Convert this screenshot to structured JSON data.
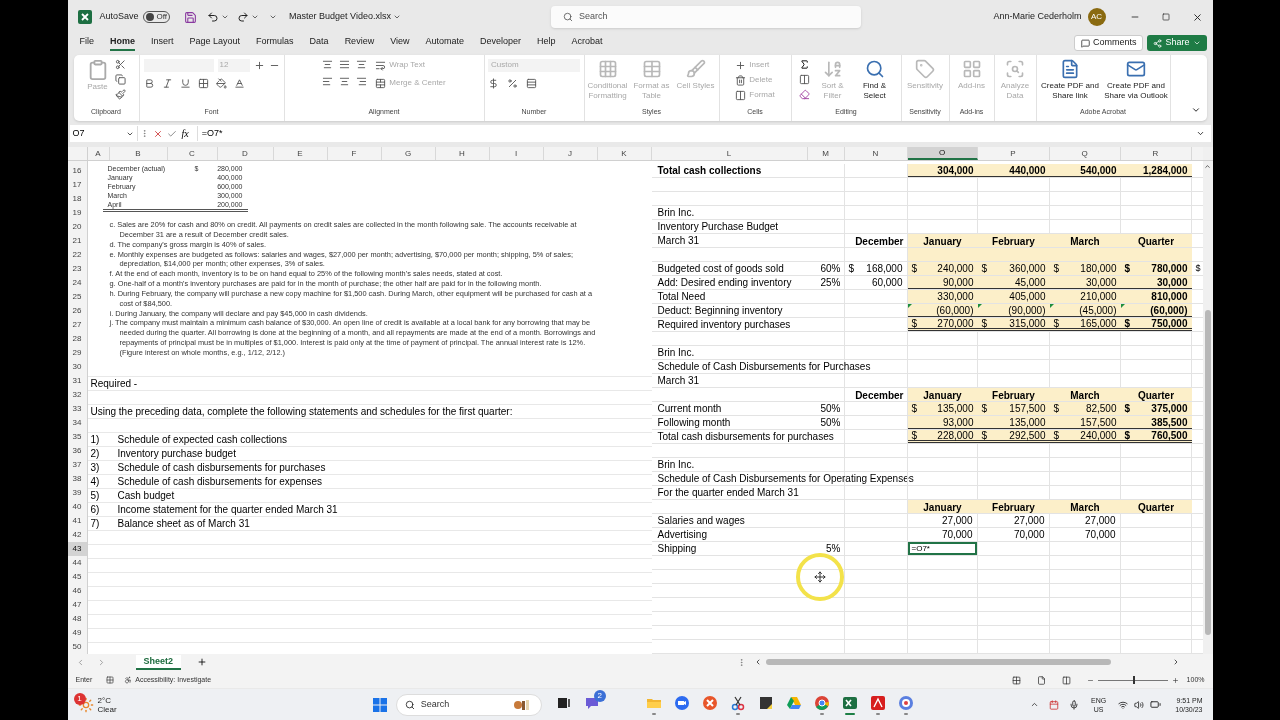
{
  "title_bar": {
    "autosave_label": "AutoSave",
    "autosave": {
      "on": false,
      "label": "Off"
    },
    "file_name": "Master Budget Video.xlsx",
    "search_placeholder": "Search",
    "user_name": "Ann-Marie Cederholm",
    "user_initials": "AC"
  },
  "menu_tabs": [
    {
      "label": "File",
      "selected": false
    },
    {
      "label": "Home",
      "selected": true
    },
    {
      "label": "Insert",
      "selected": false
    },
    {
      "label": "Page Layout",
      "selected": false
    },
    {
      "label": "Formulas",
      "selected": false
    },
    {
      "label": "Data",
      "selected": false
    },
    {
      "label": "Review",
      "selected": false
    },
    {
      "label": "View",
      "selected": false
    },
    {
      "label": "Automate",
      "selected": false
    },
    {
      "label": "Developer",
      "selected": false
    },
    {
      "label": "Help",
      "selected": false
    },
    {
      "label": "Acrobat",
      "selected": false
    }
  ],
  "comments_button": "Comments",
  "share_button": "Share",
  "ribbon": {
    "groups": [
      {
        "kind": "clipboard",
        "label": "Clipboard",
        "buttons": [
          {
            "label": "Paste",
            "disabled": true
          }
        ]
      },
      {
        "kind": "font",
        "label": "Font",
        "font_size": {
          "value": "12",
          "disabled": true
        }
      },
      {
        "kind": "alignment",
        "label": "Alignment",
        "buttons": [
          {
            "label": "Wrap Text",
            "disabled": true
          },
          {
            "label": "Merge & Center",
            "disabled": true
          }
        ]
      },
      {
        "kind": "number",
        "label": "Number",
        "format": {
          "value": "Custom",
          "disabled": true
        }
      },
      {
        "kind": "styles",
        "label": "Styles",
        "buttons": [
          {
            "label": "Conditional Formatting",
            "disabled": true
          },
          {
            "label": "Format as Table",
            "disabled": true
          },
          {
            "label": "Cell Styles",
            "disabled": true
          }
        ]
      },
      {
        "kind": "cells",
        "label": "Cells",
        "buttons": [
          {
            "label": "Insert",
            "disabled": true
          },
          {
            "label": "Delete",
            "disabled": true
          },
          {
            "label": "Format",
            "disabled": true
          }
        ]
      },
      {
        "kind": "editing",
        "label": "Editing",
        "buttons": [
          {
            "label": "Sort & Filter",
            "disabled": true
          },
          {
            "label": "Find & Select",
            "disabled": false
          }
        ]
      },
      {
        "kind": "sensitivity",
        "label": "Sensitivity",
        "buttons": [
          {
            "label": "Sensitivity",
            "disabled": true
          }
        ]
      },
      {
        "kind": "addins",
        "label": "Add-ins",
        "buttons": [
          {
            "label": "Add-ins",
            "disabled": true
          }
        ]
      },
      {
        "kind": "analyze",
        "buttons": [
          {
            "label": "Analyze Data",
            "disabled": true
          }
        ]
      },
      {
        "kind": "acrobat",
        "label": "Adobe Acrobat",
        "buttons": [
          {
            "label": "Create PDF and Share link",
            "disabled": false
          },
          {
            "label": "Create PDF and Share via Outlook",
            "disabled": false
          }
        ]
      }
    ]
  },
  "formula_bar": {
    "name_box": "O7",
    "function_label": "fx",
    "formula": "=O7*"
  },
  "columns": [
    {
      "letter": "A",
      "selected": false
    },
    {
      "letter": "B",
      "selected": false
    },
    {
      "letter": "C",
      "selected": false
    },
    {
      "letter": "D",
      "selected": false
    },
    {
      "letter": "E",
      "selected": false
    },
    {
      "letter": "F",
      "selected": false
    },
    {
      "letter": "G",
      "selected": false
    },
    {
      "letter": "H",
      "selected": false
    },
    {
      "letter": "I",
      "selected": false
    },
    {
      "letter": "J",
      "selected": false
    },
    {
      "letter": "K",
      "selected": false
    },
    {
      "letter": "L",
      "selected": false
    },
    {
      "letter": "M",
      "selected": false
    },
    {
      "letter": "N",
      "selected": false
    },
    {
      "letter": "O",
      "selected": true
    },
    {
      "letter": "P",
      "selected": false
    },
    {
      "letter": "Q",
      "selected": false
    },
    {
      "letter": "R",
      "selected": false
    }
  ],
  "row_headers": [
    {
      "label": "16",
      "selected": false
    },
    {
      "label": "17",
      "selected": false
    },
    {
      "label": "18",
      "selected": false
    },
    {
      "label": "19",
      "selected": false
    },
    {
      "label": "20",
      "selected": false
    },
    {
      "label": "21",
      "selected": false
    },
    {
      "label": "22",
      "selected": false
    },
    {
      "label": "23",
      "selected": false
    },
    {
      "label": "24",
      "selected": false
    },
    {
      "label": "25",
      "selected": false
    },
    {
      "label": "26",
      "selected": false
    },
    {
      "label": "27",
      "selected": false
    },
    {
      "label": "28",
      "selected": false
    },
    {
      "label": "29",
      "selected": false
    },
    {
      "label": "30",
      "selected": false
    },
    {
      "label": "31",
      "selected": false
    },
    {
      "label": "32",
      "selected": false
    },
    {
      "label": "33",
      "selected": false
    },
    {
      "label": "34",
      "selected": false
    },
    {
      "label": "35",
      "selected": false
    },
    {
      "label": "36",
      "selected": false
    },
    {
      "label": "37",
      "selected": false
    },
    {
      "label": "38",
      "selected": false
    },
    {
      "label": "39",
      "selected": false
    },
    {
      "label": "40",
      "selected": false
    },
    {
      "label": "41",
      "selected": false
    },
    {
      "label": "42",
      "selected": false
    },
    {
      "label": "43",
      "selected": true
    },
    {
      "label": "44",
      "selected": false
    },
    {
      "label": "45",
      "selected": false
    },
    {
      "label": "46",
      "selected": false
    },
    {
      "label": "47",
      "selected": false
    },
    {
      "label": "48",
      "selected": false
    },
    {
      "label": "49",
      "selected": false
    },
    {
      "label": "50",
      "selected": false
    }
  ],
  "sales_table": [
    {
      "month": "December (actual)",
      "sign": "$",
      "amount": "280,000"
    },
    {
      "month": "January",
      "amount": "400,000"
    },
    {
      "month": "February",
      "amount": "600,000"
    },
    {
      "month": "March",
      "amount": "300,000"
    },
    {
      "month": "April",
      "amount": "200,000"
    }
  ],
  "notes": [
    "c. Sales are 20% for cash and 80% on credit. All payments on credit sales are collected in the month following sale. The accounts receivable at December 31 are a result of December credit sales.",
    "d. The company's gross margin is 40% of sales.",
    "e. Monthly expenses are budgeted as follows: salaries and wages, $27,000 per month; advertising, $70,000 per month; shipping, 5% of sales; depreciation, $14,000 per month; other expenses, 3% of sales.",
    "f. At the end of each month, inventory is to be on hand equal to 25% of the following month's sales needs, stated at cost.",
    "g. One-half of a month's inventory purchases are paid for in the month of purchase; the other half are paid for in the following month.",
    "h. During February, the company will purchase a new copy machine for $1,500 cash. During March, other equipment will be purchased for cash at a cost of $84,500.",
    "i. During January, the company will declare and pay $45,000 in cash dividends.",
    "j. The company must maintain a minimum cash balance of $30,000. An open line of credit is available at a local bank for any borrowing that may be needed during the quarter. All borrowing is done at the beginning of a month, and all repayments are made at the end of a month. Borrowings and repayments of principal must be in multiples of $1,000. Interest is paid only at the time of payment of principal. The annual interest rate is 12%. (Figure interest on whole months, e.g., 1/12, 2/12.)"
  ],
  "required": "Required -",
  "instructions": "Using the preceding data, complete the following statements and schedules for the first quarter:",
  "tasks": [
    {
      "number": "1)",
      "text": "Schedule of expected cash collections"
    },
    {
      "number": "2)",
      "text": "Inventory purchase budget"
    },
    {
      "number": "3)",
      "text": "Schedule of cash disbursements for purchases"
    },
    {
      "number": "4)",
      "text": "Schedule of cash disbursements for expenses"
    },
    {
      "number": "5)",
      "text": "Cash budget"
    },
    {
      "number": "6)",
      "text": "Income statement for the quarter ended March 31"
    },
    {
      "number": "7)",
      "text": "Balance sheet as of March 31"
    }
  ],
  "budget_rows": [
    {
      "kind": "data",
      "label": "Total cash collections",
      "bold": true,
      "fill": true,
      "underline": true,
      "cells": [
        {
          "kind": "amount",
          "amount": "304,000",
          "bold": true
        },
        {
          "kind": "amount",
          "amount": "440,000",
          "bold": true
        },
        {
          "kind": "amount",
          "amount": "540,000",
          "bold": true
        },
        {
          "kind": "amount",
          "amount": "1,284,000",
          "bold": true
        }
      ]
    },
    {
      "kind": "blank"
    },
    {
      "kind": "blank"
    },
    {
      "kind": "data",
      "label": "Brin Inc."
    },
    {
      "kind": "data",
      "label": "Inventory Purchase Budget"
    },
    {
      "kind": "header",
      "label": "March 31",
      "december": "December",
      "fill": true,
      "headings": [
        "January",
        "February",
        "March",
        "Quarter"
      ]
    },
    {
      "kind": "blank",
      "fill": true
    },
    {
      "kind": "data",
      "label": "Budgeted cost of goods sold",
      "rate": "60%",
      "december": {
        "sign": "$",
        "amount": "168,000"
      },
      "fill": true,
      "overflow": "$",
      "cells": [
        {
          "kind": "amount",
          "sign": "$",
          "amount": "240,000"
        },
        {
          "kind": "amount",
          "sign": "$",
          "amount": "360,000"
        },
        {
          "kind": "amount",
          "sign": "$",
          "amount": "180,000"
        },
        {
          "kind": "amount",
          "sign": "$",
          "amount": "780,000",
          "bold": true
        }
      ]
    },
    {
      "kind": "data",
      "label": "Add: Desired ending inventory",
      "rate": "25%",
      "december": {
        "amount": "60,000"
      },
      "fill": true,
      "underline": true,
      "cells": [
        {
          "kind": "amount",
          "amount": "90,000"
        },
        {
          "kind": "amount",
          "amount": "45,000"
        },
        {
          "kind": "amount",
          "amount": "30,000"
        },
        {
          "kind": "amount",
          "amount": "30,000",
          "bold": true
        }
      ]
    },
    {
      "kind": "data",
      "label": "Total Need",
      "fill": true,
      "cells": [
        {
          "kind": "amount",
          "amount": "330,000"
        },
        {
          "kind": "amount",
          "amount": "405,000"
        },
        {
          "kind": "amount",
          "amount": "210,000"
        },
        {
          "kind": "amount",
          "amount": "810,000",
          "bold": true
        }
      ]
    },
    {
      "kind": "data",
      "label": "Deduct:  Beginning inventory",
      "fill": true,
      "underline": true,
      "cells": [
        {
          "kind": "amount",
          "amount": "(60,000)",
          "flag": true
        },
        {
          "kind": "amount",
          "amount": "(90,000)",
          "flag": true
        },
        {
          "kind": "amount",
          "amount": "(45,000)",
          "flag": true
        },
        {
          "kind": "amount",
          "amount": "(60,000)",
          "bold": true,
          "flag": true
        }
      ]
    },
    {
      "kind": "data",
      "label": "Required inventory purchases",
      "fill": true,
      "double_underline": true,
      "cells": [
        {
          "kind": "amount",
          "sign": "$",
          "amount": "270,000"
        },
        {
          "kind": "amount",
          "sign": "$",
          "amount": "315,000"
        },
        {
          "kind": "amount",
          "sign": "$",
          "amount": "165,000"
        },
        {
          "kind": "amount",
          "sign": "$",
          "amount": "750,000",
          "bold": true
        }
      ]
    },
    {
      "kind": "blank"
    },
    {
      "kind": "data",
      "label": "Brin Inc."
    },
    {
      "kind": "data",
      "label": "Schedule of Cash Disbursements for Purchases"
    },
    {
      "kind": "data",
      "label": "March 31"
    },
    {
      "kind": "header",
      "december": "December",
      "fill": true,
      "headings": [
        "January",
        "February",
        "March",
        "Quarter"
      ]
    },
    {
      "kind": "data",
      "label": "Current month",
      "rate": "50%",
      "fill": true,
      "cells": [
        {
          "kind": "amount",
          "sign": "$",
          "amount": "135,000"
        },
        {
          "kind": "amount",
          "sign": "$",
          "amount": "157,500"
        },
        {
          "kind": "amount",
          "sign": "$",
          "amount": "82,500"
        },
        {
          "kind": "amount",
          "sign": "$",
          "amount": "375,000",
          "bold": true
        }
      ]
    },
    {
      "kind": "data",
      "label": "Following month",
      "rate": "50%",
      "fill": true,
      "underline": true,
      "cells": [
        {
          "kind": "amount",
          "amount": "93,000"
        },
        {
          "kind": "amount",
          "amount": "135,000"
        },
        {
          "kind": "amount",
          "amount": "157,500"
        },
        {
          "kind": "amount",
          "amount": "385,500",
          "bold": true
        }
      ]
    },
    {
      "kind": "data",
      "label": "Total cash disbursements for purchases",
      "fill": true,
      "double_underline": true,
      "cells": [
        {
          "kind": "amount",
          "sign": "$",
          "amount": "228,000"
        },
        {
          "kind": "amount",
          "sign": "$",
          "amount": "292,500"
        },
        {
          "kind": "amount",
          "sign": "$",
          "amount": "240,000"
        },
        {
          "kind": "amount",
          "sign": "$",
          "amount": "760,500",
          "bold": true
        }
      ]
    },
    {
      "kind": "blank"
    },
    {
      "kind": "data",
      "label": "Brin Inc."
    },
    {
      "kind": "data",
      "label": "Schedule of Cash Disbursements for Operating Expenses"
    },
    {
      "kind": "data",
      "label": "For the quarter ended March 31"
    },
    {
      "kind": "header",
      "fill": true,
      "headings": [
        "January",
        "February",
        "March",
        "Quarter"
      ]
    },
    {
      "kind": "data",
      "label": "Salaries and wages",
      "cells": [
        {
          "kind": "amount",
          "amount": "27,000"
        },
        {
          "kind": "amount",
          "amount": "27,000"
        },
        {
          "kind": "amount",
          "amount": "27,000"
        }
      ]
    },
    {
      "kind": "data",
      "label": "Advertising",
      "cells": [
        {
          "kind": "amount",
          "amount": "70,000"
        },
        {
          "kind": "amount",
          "amount": "70,000"
        },
        {
          "kind": "amount",
          "amount": "70,000"
        }
      ]
    },
    {
      "kind": "data",
      "label": "Shipping",
      "rate": "5%",
      "cells": [
        {
          "kind": "input",
          "value": "=O7*"
        }
      ]
    },
    {
      "kind": "blank"
    },
    {
      "kind": "blank"
    },
    {
      "kind": "blank"
    },
    {
      "kind": "blank"
    },
    {
      "kind": "blank"
    },
    {
      "kind": "blank"
    },
    {
      "kind": "blank"
    }
  ],
  "sheet_tabs": [
    {
      "label": "Sheet2",
      "selected": true
    }
  ],
  "status_bar": {
    "mode": "Enter",
    "accessibility": "Accessibility: Investigate",
    "zoom": {
      "level": 0.5,
      "label": "100%"
    }
  },
  "taskbar": {
    "weather": {
      "badge": "1",
      "temperature": "2°C",
      "condition": "Clear"
    },
    "search_placeholder": "Search",
    "apps": [
      {
        "kind": "task_view",
        "running": false,
        "selected": false
      },
      {
        "kind": "chat",
        "badge": "2",
        "running": false,
        "selected": false
      },
      {
        "kind": "explorer",
        "running": true,
        "selected": false
      },
      {
        "kind": "video",
        "running": false,
        "selected": false
      },
      {
        "kind": "orange",
        "running": false,
        "selected": false
      },
      {
        "kind": "tool",
        "running": true,
        "selected": false
      },
      {
        "kind": "notes",
        "running": false,
        "selected": false
      },
      {
        "kind": "drive",
        "running": false,
        "selected": false
      },
      {
        "kind": "browser",
        "running": true,
        "selected": false
      },
      {
        "kind": "spreadsheet",
        "running": true,
        "selected": true
      },
      {
        "kind": "pdf",
        "running": true,
        "selected": false
      },
      {
        "kind": "camera",
        "running": true,
        "selected": false
      }
    ],
    "language": "ENG",
    "region": "US",
    "time": "9:51 PM",
    "date": "10/30/23"
  }
}
